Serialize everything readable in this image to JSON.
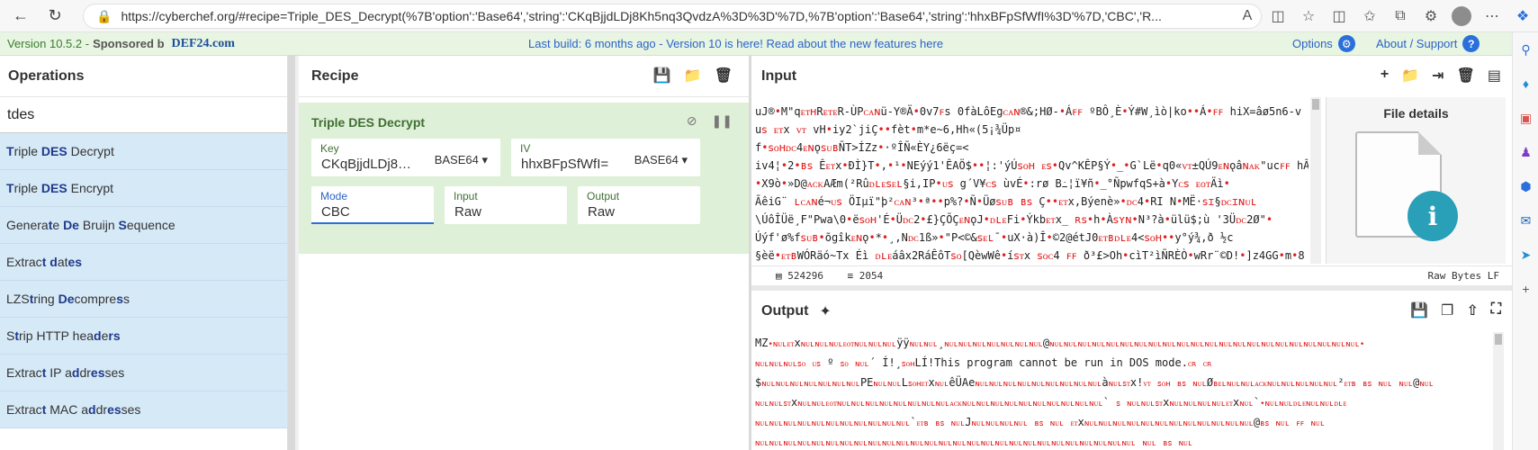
{
  "browser": {
    "url": "https://cyberchef.org/#recipe=Triple_DES_Decrypt(%7B'option':'Base64','string':'CKqBjjdLDj8Kh5nq3QvdzA%3D%3D'%7D,%7B'option':'Base64','string':'hhxBFpSfWfI%3D'%7D,'CBC','R..."
  },
  "banner": {
    "version": "Version 10.5.2 -",
    "sponsored": "Sponsored b",
    "sponsor_name": "DEF24.com",
    "build": "Last build: 6 months ago - Version 10 is here! Read about the new features here",
    "options": "Options",
    "support": "About / Support"
  },
  "operations": {
    "title": "Operations",
    "search": "tdes",
    "items": [
      {
        "pre": "T",
        "hl": "riple",
        "rest": " DES Decrypt",
        "label": "Triple DES Decrypt"
      },
      {
        "label": "Triple DES Encrypt"
      },
      {
        "label": "Generate De Bruijn Sequence"
      },
      {
        "label": "Extract dates"
      },
      {
        "label": "LZString Decompress"
      },
      {
        "label": "Strip HTTP headers"
      },
      {
        "label": "Extract IP addresses"
      },
      {
        "label": "Extract MAC addresses"
      }
    ]
  },
  "recipe": {
    "title": "Recipe",
    "op_title": "Triple DES Decrypt",
    "key_label": "Key",
    "key_value": "CKqBjjdLDj8…",
    "key_format": "BASE64",
    "iv_label": "IV",
    "iv_value": "hhxBFpSfWfI=",
    "iv_format": "BASE64",
    "mode_label": "Mode",
    "mode_value": "CBC",
    "input_label": "Input",
    "input_value": "Raw",
    "output_label": "Output",
    "output_value": "Raw"
  },
  "input": {
    "title": "Input",
    "lines": [
      "uJ®•M\"qᴇᴛʜRᴇᴛᴇR-ÙPᴄᴀɴü-Y®Ä•0v7ꜰs 0fàLôEgᴄᴀɴ®&;HØ-•Áꜰꜰ ºBÔ¸È•Ý#W¸ìò|ko••Á•ꜰꜰ hiX=âø5n6-v",
      "uꜱ ᴇᴛx ᴠᴛ vH•iy2`jiÇ••fèt•m*e~6,Hh«(5¡¾Üp¤",
      "f•ꜱᴏʜᴅᴄ4ᴇɴǫꜱᴜʙÑT>ÍZz•·ºÎÑ«ÈY¿6ëç=<",
      "iv4¦•2•ʙꜱ Êᴇᴛx•ÐÌ}T•,•¹•NEýý1'ÊAÖ$••¦:'ýÚꜱᴏʜ ᴇꜱ•Qv^KÊP§Ý•_•G`Lë•q0«ᴠᴛ±QÚ9ᴇɴǫâɴᴀᴋ\"ucꜰꜰ hÂ",
      "•X9ò•»D@ᴀᴄᴋAÆm(²Rûᴅʟᴇꜱᴇʟ§i,IP•ᴜꜱ g´V¥ᴄꜱ ùvÉ•:rø   B߸¦ï¥ñ•_°ÑpwfqS+à•Yᴄꜱ ᴇᴏᴛÄì•",
      "ÃêiG¨   ʟᴄᴀɴé¬ᴜꜱ ÖIµï\"þ²ᴄᴀɴ³•ª••p%?•Ñ•Üøꜱᴜʙ ʙꜱ Ç••ᴇᴛx,Býenè»•ᴅᴄ4•RI   N•MË·ꜱɪ§ᴅᴄɪɴᴜʟ",
      "\\ÚôÎÜë¸F\"Pwa\\0•ëꜱᴏʜ'É•Üᴅᴄ2•£}ÇÕÇᴇɴǫJ•ᴅʟᴇFi•Ýkbᴇᴛx_ ʀꜱ•h•Àꜱʏɴ•N³?à•ülü$;ù '3Üᴅᴄ2Ø\"•",
      "Úýf'ø%fꜱᴜʙ•õgîkᴇɴǫ•*•¸,Nᴅᴄ1ß»•\"P<©&ꜱᴇʟ¯•uX·à)Î•©2@étJ0ᴇᴛʙᴅʟᴇ4<ꜱᴏʜ••y°ý¾,ð ½c",
      "§èë•ᴇᴛʙWÓRäó~Tx Éì ᴅʟᴇáâx2RáÊôTꜱᴏ[QèwWê•íꜱᴛx ꜱᴏᴄ4 ꜰꜰ ð³£>Oh•cìT²ìÑRÈÒ•wRr¨©D!•]z4GG•m•8"
    ],
    "status_length": "524296",
    "status_lines": "2054",
    "status_right": "Raw Bytes   LF",
    "file_details_title": "File details"
  },
  "output": {
    "title": "Output",
    "lines": [
      "MZ•ɴᴜʟᴇᴛxɴᴜʟɴᴜʟɴᴜʟᴇᴏᴛɴᴜʟɴᴜʟɴᴜʟÿÿɴᴜʟɴᴜʟ¸ɴᴜʟɴᴜʟɴᴜʟɴᴜʟɴᴜʟɴᴜʟɴᴜʟ@ɴᴜʟɴᴜʟɴᴜʟɴᴜʟɴᴜʟɴᴜʟɴᴜʟɴᴜʟɴᴜʟɴᴜʟɴᴜʟɴᴜʟɴᴜʟɴᴜʟɴᴜʟɴᴜʟɴᴜʟɴᴜʟɴᴜʟɴᴜʟɴᴜʟɴᴜʟ•",
      "ɴᴜʟɴᴜʟɴᴜʟꜱᴏ ᴜꜱ º ꜱᴏ ɴᴜʟ´ Í!¸ꜱᴏʜLÍ!This program cannot be run in DOS mode.ᴄʀ ᴄʀ",
      "$ɴᴜʟɴᴜʟɴᴜʟɴᴜʟɴᴜʟɴᴜʟɴᴜʟPEɴᴜʟɴᴜʟLꜱᴏʜᴇᴛxɴᴜʟêÜAeɴᴜʟɴᴜʟɴᴜʟɴᴜʟɴᴜʟɴᴜʟɴᴜʟɴᴜʟɴᴜʟàɴᴜʟꜱᴛx!ᴠᴛ ꜱᴏʜ ʙꜱ ɴᴜʟØʙᴇʟɴᴜʟɴᴜʟᴀᴄᴋɴᴜʟɴᴜʟɴᴜʟɴᴜʟɴᴜʟ²ᴇᴛʙ ʙꜱ ɴᴜʟ  ɴᴜʟ@ɴᴜʟ",
      " ɴᴜʟɴᴜʟꜱᴛxɴᴜʟɴᴜʟᴇᴏᴛɴᴜʟɴᴜʟɴᴜʟɴᴜʟɴᴜʟɴᴜʟɴᴜʟɴᴜʟᴀᴄᴋɴᴜʟɴᴜʟɴᴜʟɴᴜʟɴᴜʟɴᴜʟɴᴜʟɴᴜʟɴᴜʟɴᴜʟ` ꜱ ɴᴜʟɴᴜʟꜱᴛxɴᴜʟɴᴜʟɴᴜʟɴᴜʟᴇᴛxɴᴜʟ`•ɴᴜʟɴᴜʟᴅʟᴇɴᴜʟɴᴜʟᴅʟᴇ",
      " ɴᴜʟɴᴜʟɴᴜʟɴᴜʟɴᴜʟɴᴜʟɴᴜʟɴᴜʟɴᴜʟɴᴜʟɴᴜʟ`ᴇᴛʙ ʙꜱ ɴᴜʟJɴᴜʟɴᴜʟɴᴜʟɴᴜʟ ʙꜱ ɴᴜʟ ᴇᴛxɴᴜʟɴᴜʟɴᴜʟɴᴜʟɴᴜʟɴᴜʟɴᴜʟɴᴜʟɴᴜʟɴᴜʟɴᴜʟɴᴜʟ@ʙꜱ ɴᴜʟ ꜰꜰ ɴᴜʟ",
      "ɴᴜʟɴᴜʟɴᴜʟɴᴜʟɴᴜʟɴᴜʟɴᴜʟɴᴜʟɴᴜʟɴᴜʟɴᴜʟɴᴜʟɴᴜʟɴᴜʟɴᴜʟɴᴜʟɴᴜʟɴᴜʟɴᴜʟɴᴜʟɴᴜʟɴᴜʟɴᴜʟɴᴜʟɴᴜʟɴᴜʟɴᴜʟ ɴᴜʟ ʙꜱ ɴᴜʟ"
    ]
  },
  "icons": {
    "save": "save-icon",
    "folder": "folder-icon",
    "trash": "trash-icon"
  }
}
